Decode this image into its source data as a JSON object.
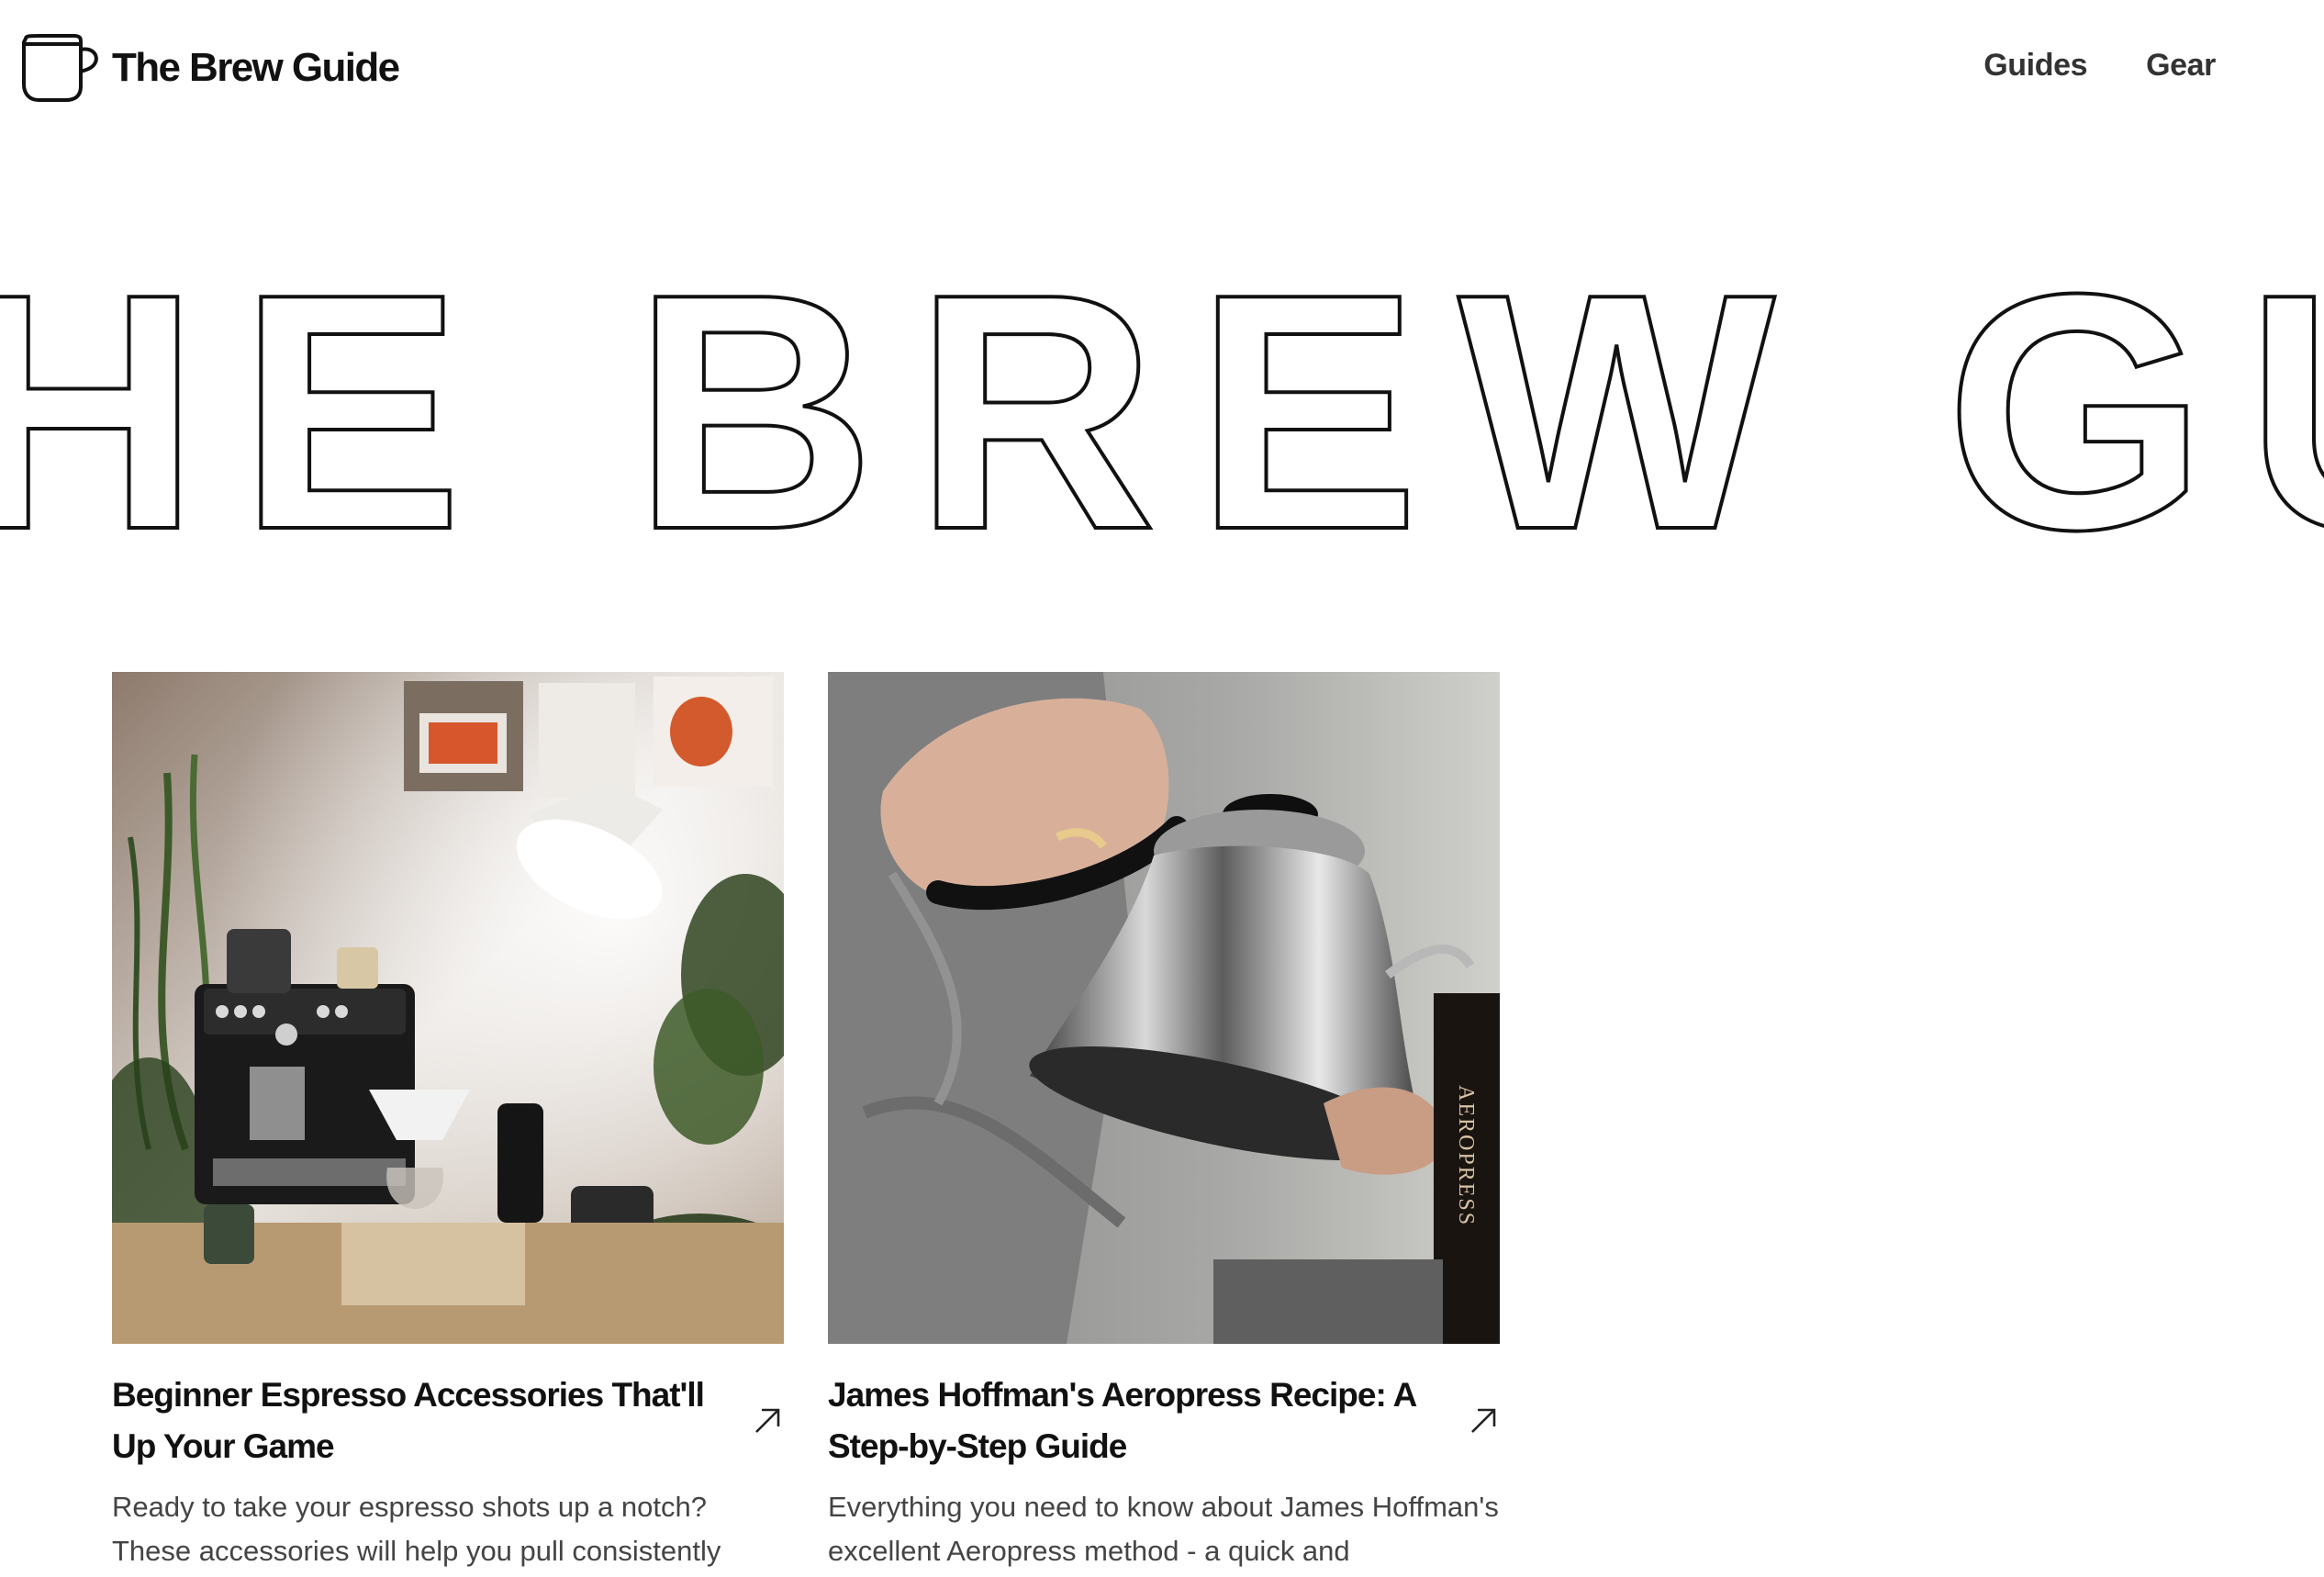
{
  "header": {
    "brand_name": "The Brew Guide",
    "brand_icon": "coffee-mug-icon",
    "nav": [
      {
        "label": "Guides"
      },
      {
        "label": "Gear"
      }
    ]
  },
  "hero": {
    "text": "THE BREW GUIDE"
  },
  "cards": [
    {
      "title": "Beginner Espresso Accessories That'll Up Your Game",
      "description": "Ready to take your espresso shots up a notch? These accessories will help you pull consistently",
      "image": "espresso-machine-photo",
      "arrow_icon": "arrow-up-right-icon"
    },
    {
      "title": "James Hoffman's Aeropress Recipe: A Step-by-Step Guide",
      "description": "Everything you need to know about James Hoffman's excellent Aeropress method - a quick and",
      "image": "kettle-pour-photo",
      "image_label": "AEROPRESS",
      "arrow_icon": "arrow-up-right-icon"
    }
  ],
  "colors": {
    "text": "#111111",
    "muted": "#444444",
    "background": "#ffffff"
  }
}
